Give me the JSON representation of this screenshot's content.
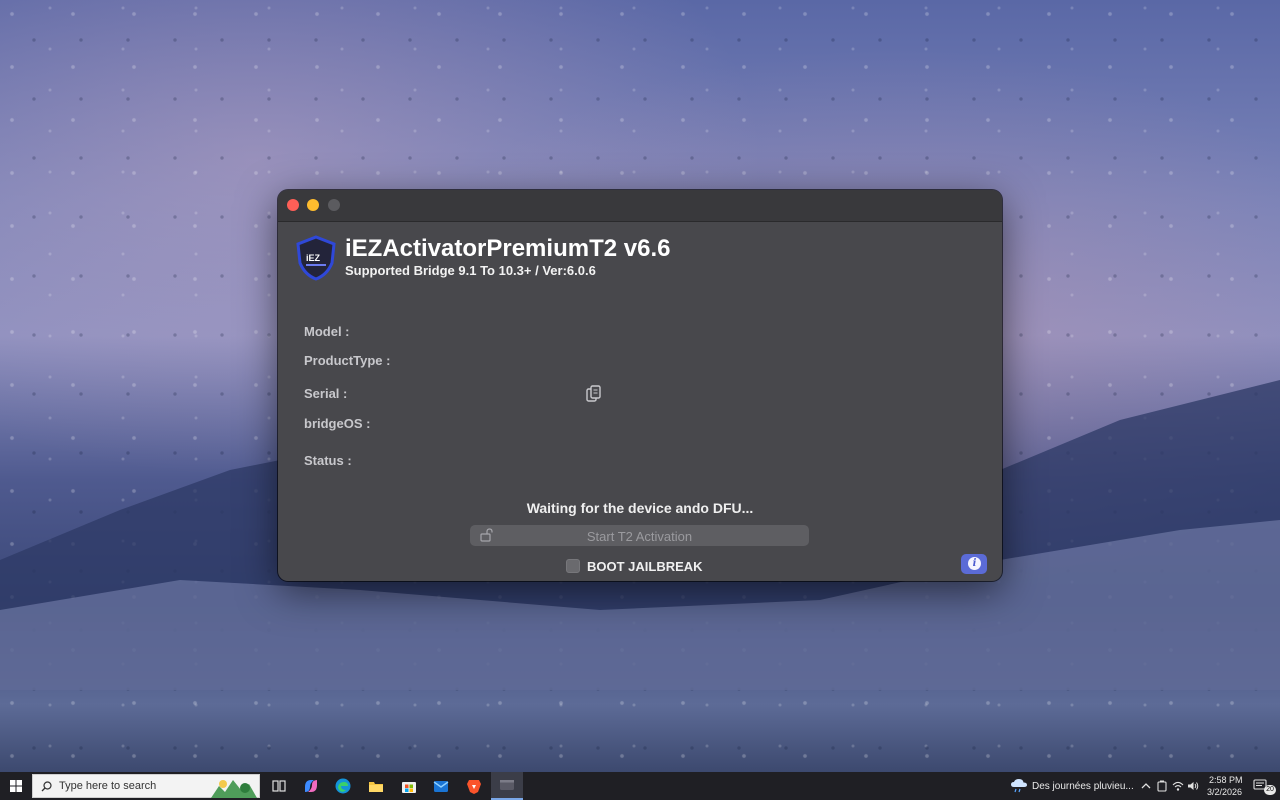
{
  "app": {
    "title": "iEZActivatorPremiumT2 v6.6",
    "subtitle": "Supported Bridge 9.1 To 10.3+ / Ver:6.0.6",
    "logo_text": "iEZ"
  },
  "device_info": {
    "model_label": "Model :",
    "product_type_label": "ProductType :",
    "serial_label": "Serial :",
    "bridgeos_label": "bridgeOS :",
    "status_label": "Status :"
  },
  "status_message": "Waiting for the device ando DFU...",
  "actions": {
    "start_label": "Start T2 Activation",
    "jailbreak_label": "BOOT JAILBREAK",
    "info_glyph": "i"
  },
  "taskbar": {
    "search_placeholder": "Type here to search",
    "weather_text": "Des journées pluvieu...",
    "time": "2:58 PM",
    "date": "3/2/2026",
    "notification_count": "20"
  },
  "colors": {
    "window_bg": "#48484c",
    "titlebar_bg": "#39393c",
    "close": "#fe5f57",
    "minimize": "#febc2e",
    "accent": "#5b6bd6",
    "logo_blue": "#2f48d8"
  }
}
